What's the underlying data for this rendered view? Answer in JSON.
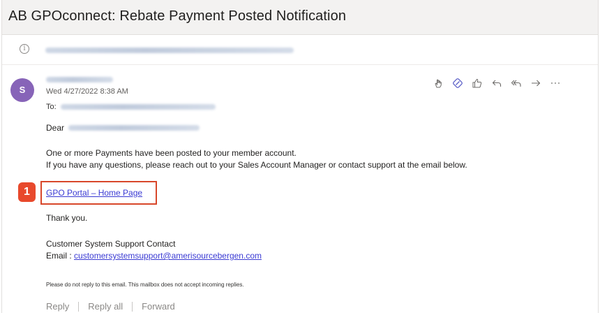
{
  "email": {
    "subject": "AB GPOconnect: Rebate Payment Posted Notification",
    "info_icon": "info-icon",
    "sender_initial": "S",
    "timestamp": "Wed 4/27/2022 8:38 AM",
    "to_label": "To:",
    "greeting": "Dear",
    "body_line_1": "One or more Payments have been posted to your member account.",
    "body_line_2": "If you have any questions, please reach out to your Sales Account Manager or contact support at the email below.",
    "portal_link": "GPO Portal – Home Page",
    "thanks": "Thank you.",
    "support_heading": "Customer System Support Contact",
    "email_label": "Email :",
    "support_email": "customersystemsupport@amerisourcebergen.com",
    "no_reply_note": "Please do not reply to this email. This mailbox does not accept incoming replies."
  },
  "toolbar": {
    "icons": [
      "hand-icon",
      "loop-icon",
      "like-icon",
      "reply-icon",
      "reply-all-icon",
      "forward-icon",
      "more-icon"
    ]
  },
  "footer": {
    "reply": "Reply",
    "reply_all": "Reply all",
    "forward": "Forward"
  },
  "callout": {
    "number": "1",
    "color": "#e8492c"
  },
  "colors": {
    "avatar": "#8764b8",
    "link": "#3a3ad3",
    "highlight_border": "#d8472a"
  }
}
